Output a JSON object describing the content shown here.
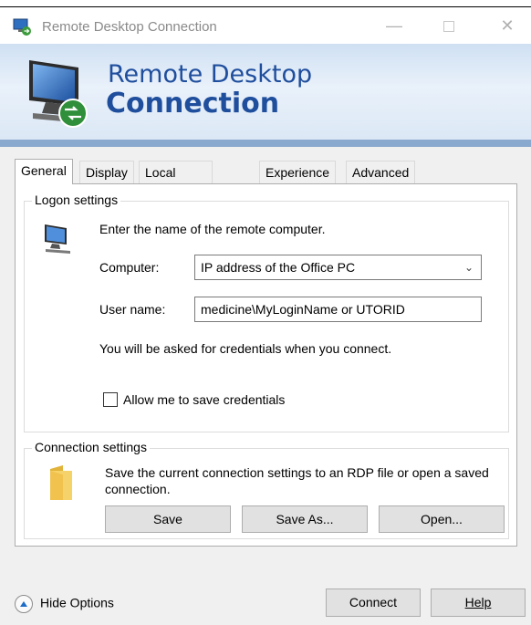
{
  "window": {
    "title": "Remote Desktop Connection",
    "minimize_glyph": "—",
    "close_glyph": "✕"
  },
  "banner": {
    "line1": "Remote Desktop",
    "line2": "Connection",
    "icon": "monitor-connection-icon"
  },
  "tabs": [
    {
      "label": "General",
      "active": true
    },
    {
      "label": "Display",
      "active": false
    },
    {
      "label": "Local Resources",
      "active": false
    },
    {
      "label": "Experience",
      "active": false
    },
    {
      "label": "Advanced",
      "active": false
    }
  ],
  "logon": {
    "title": "Logon settings",
    "instruction": "Enter the name of the remote computer.",
    "computer_label": "Computer:",
    "computer_value": "IP address of the Office PC",
    "username_label": "User name:",
    "username_value": "medicine\\MyLoginName or UTORID",
    "credentials_note": "You will be asked for credentials when you connect.",
    "save_credentials_label": "Allow me to save credentials",
    "save_credentials_checked": false
  },
  "connection": {
    "title": "Connection settings",
    "description": "Save the current connection settings to an RDP file or open a saved connection.",
    "save": "Save",
    "save_as": "Save As...",
    "open": "Open..."
  },
  "footer": {
    "hide_options": "Hide Options",
    "connect": "Connect",
    "help": "Help"
  }
}
